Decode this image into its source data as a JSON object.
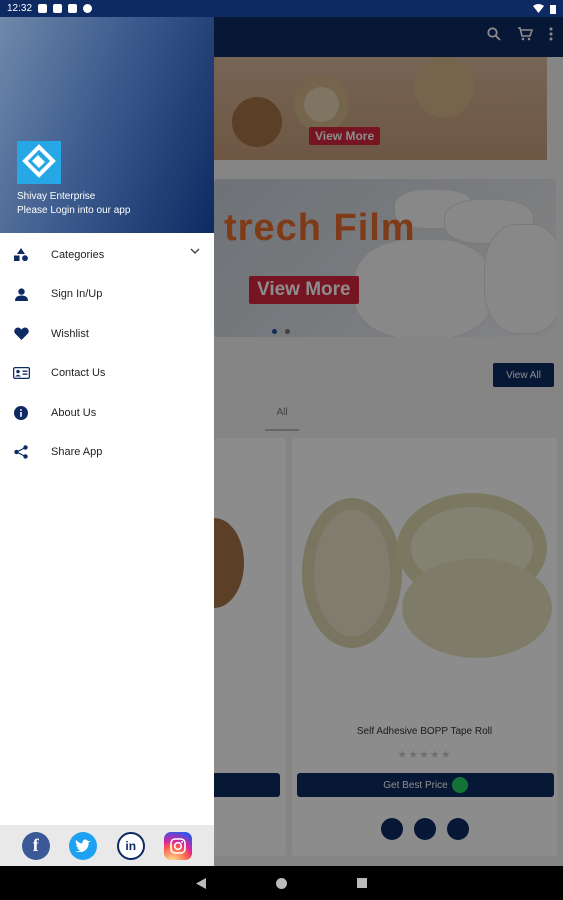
{
  "status_bar": {
    "time": "12:32"
  },
  "drawer": {
    "company_name": "Shivay Enterprise",
    "login_message": "Please Login into our app",
    "menu": [
      {
        "label": "Categories",
        "icon": "categories-icon"
      },
      {
        "label": "Sign In/Up",
        "icon": "person-icon"
      },
      {
        "label": "Wishlist",
        "icon": "heart-icon"
      },
      {
        "label": "Contact Us",
        "icon": "contact-card-icon"
      },
      {
        "label": "About Us",
        "icon": "info-icon"
      },
      {
        "label": "Share App",
        "icon": "share-icon"
      }
    ],
    "social": [
      "facebook",
      "twitter",
      "linkedin",
      "instagram"
    ],
    "colors": {
      "header_start": "#6f88aa",
      "header_end": "#0e2a63",
      "accent": "#0e2a63"
    }
  },
  "background": {
    "banner1_button": "View More",
    "banner2_title": "trech Film",
    "banner2_button": "View More",
    "view_all": "View All",
    "tab_all": "All",
    "product": {
      "name": "Self Adhesive BOPP Tape Roll",
      "best_price": "Get Best Price"
    }
  }
}
